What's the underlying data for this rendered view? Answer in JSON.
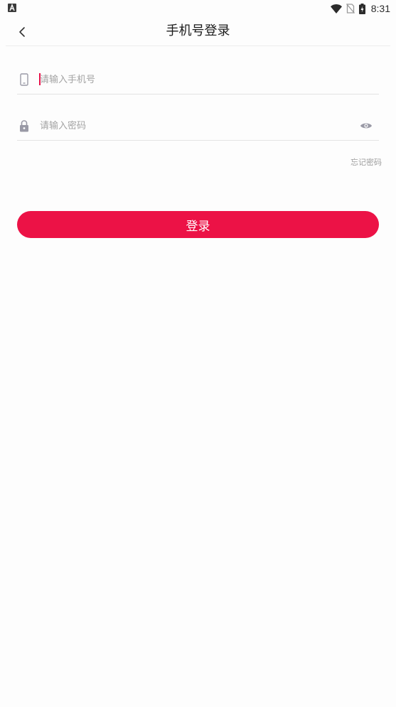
{
  "status_bar": {
    "time": "8:31",
    "notification_icon": "a-box-icon",
    "icons": [
      "wifi-icon",
      "no-sim-icon",
      "battery-charging-icon"
    ]
  },
  "header": {
    "title": "手机号登录",
    "back_icon": "chevron-left-icon"
  },
  "form": {
    "phone": {
      "icon": "phone-icon",
      "placeholder": "请输入手机号",
      "value": ""
    },
    "password": {
      "icon": "lock-icon",
      "placeholder": "请输入密码",
      "value": "",
      "toggle_icon": "eye-icon"
    },
    "forgot_password": "忘记密码",
    "submit_label": "登录"
  },
  "colors": {
    "accent": "#ec1246",
    "placeholder": "#a3a3a3",
    "divider": "#e3e3e3",
    "icon": "#9a9aa6"
  }
}
